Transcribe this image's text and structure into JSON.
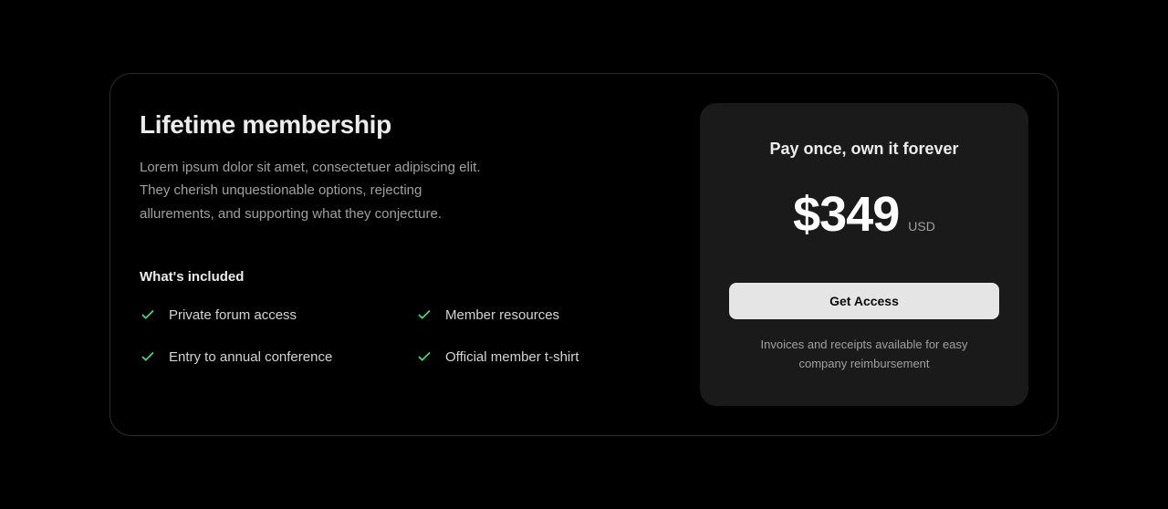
{
  "plan": {
    "title": "Lifetime membership",
    "description": "Lorem ipsum dolor sit amet, consectetuer adipiscing elit. They cherish unquestionable options, rejecting allurements, and supporting what they conjecture.",
    "included_heading": "What's included",
    "features": [
      "Private forum access",
      "Member resources",
      "Entry to annual conference",
      "Official member t-shirt"
    ]
  },
  "pricing": {
    "heading": "Pay once, own it forever",
    "price": "$349",
    "currency": "USD",
    "cta_label": "Get Access",
    "footnote": "Invoices and receipts available for easy company reimbursement"
  }
}
